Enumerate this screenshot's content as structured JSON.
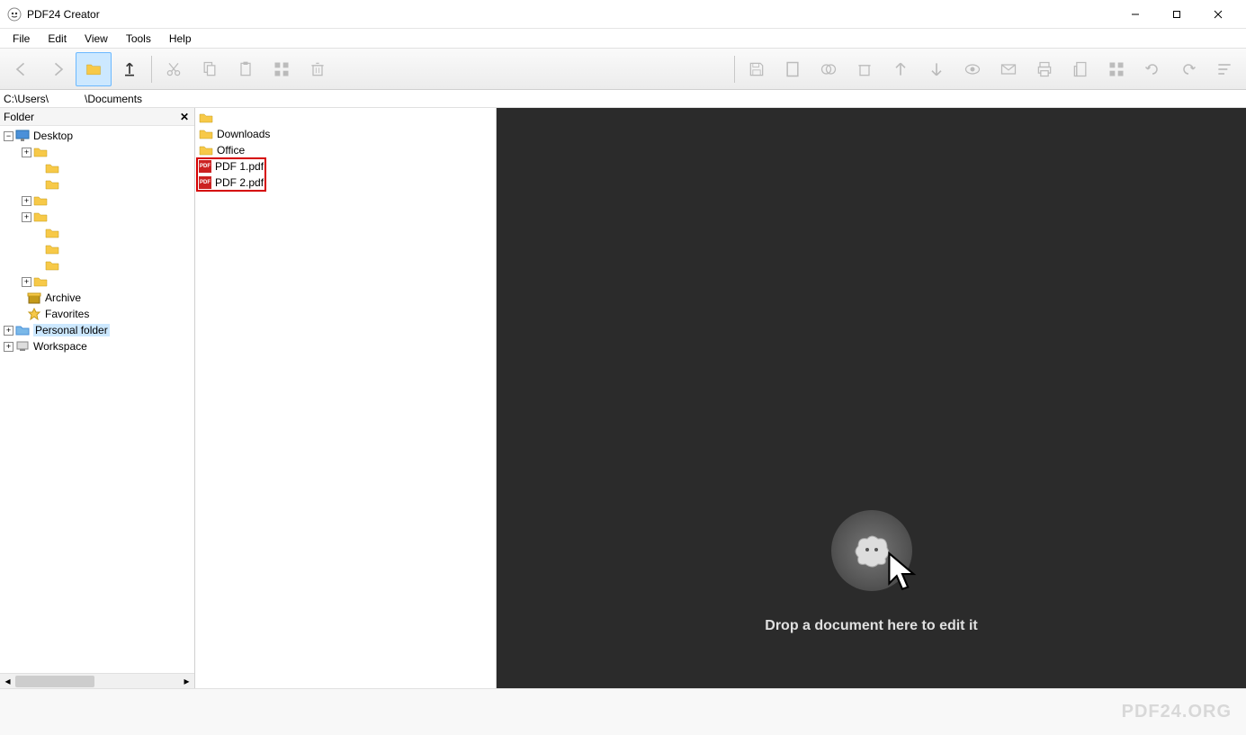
{
  "app": {
    "title": "PDF24 Creator"
  },
  "menu": {
    "file": "File",
    "edit": "Edit",
    "view": "View",
    "tools": "Tools",
    "help": "Help"
  },
  "path": {
    "left": "C:\\Users\\",
    "right": "\\Documents"
  },
  "tree": {
    "header": "Folder",
    "desktop": "Desktop",
    "archive": "Archive",
    "favorites": "Favorites",
    "personal": "Personal folder",
    "workspace": "Workspace"
  },
  "files": {
    "downloads": "Downloads",
    "office": "Office",
    "pdf1": "PDF 1.pdf",
    "pdf2": "PDF 2.pdf"
  },
  "dropzone": {
    "text": "Drop a document here to edit it"
  },
  "brand": {
    "text": "PDF24.ORG"
  }
}
